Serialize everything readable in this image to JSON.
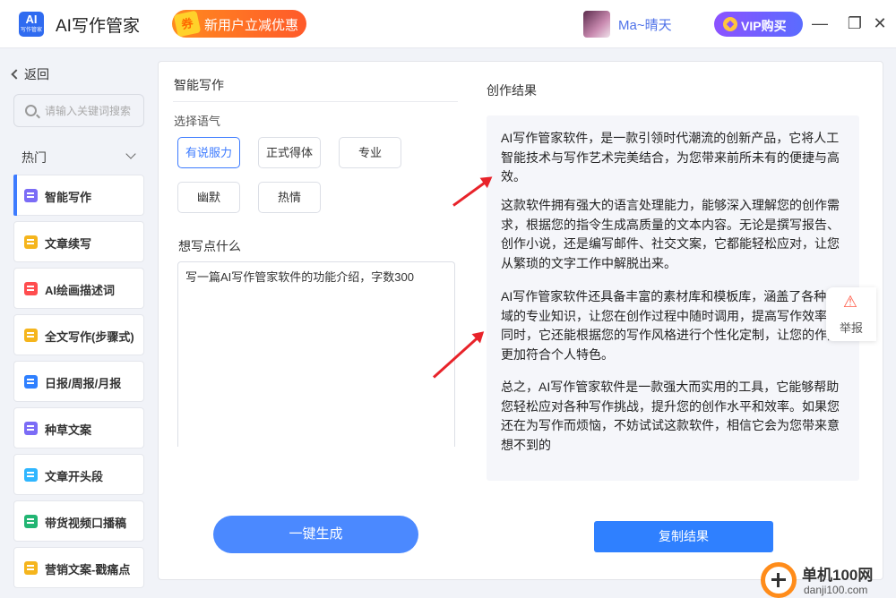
{
  "app": {
    "logo_text": "AI",
    "logo_sub": "写作管家",
    "title": "AI写作管家",
    "promo": "新用户立减优惠",
    "promo_ticket": "券",
    "username": "Ma~晴天",
    "vip_label": "VIP购买"
  },
  "window_controls": {
    "minimize": "—",
    "maximize": "❐",
    "close": "✕"
  },
  "sidebar": {
    "back_label": "返回",
    "search_placeholder": "请输入关键词搜索",
    "section_title": "热门",
    "items": [
      {
        "label": "智能写作",
        "icon": "document-icon",
        "color": "#7b6cf6",
        "active": true
      },
      {
        "label": "文章续写",
        "icon": "notes-icon",
        "color": "#f5b51d",
        "active": false
      },
      {
        "label": "AI绘画描述词",
        "icon": "palette-icon",
        "color": "#ff4d4f",
        "active": false
      },
      {
        "label": "全文写作(步骤式)",
        "icon": "notes-icon",
        "color": "#f5b51d",
        "active": false
      },
      {
        "label": "日报/周报/月报",
        "icon": "calendar-icon",
        "color": "#2f80ff",
        "active": false
      },
      {
        "label": "种草文案",
        "icon": "save-icon",
        "color": "#7b6cf6",
        "active": false
      },
      {
        "label": "文章开头段",
        "icon": "document-icon",
        "color": "#2fb6ff",
        "active": false
      },
      {
        "label": "带货视频口播稿",
        "icon": "video-icon",
        "color": "#22b573",
        "active": false
      },
      {
        "label": "营销文案-戳痛点",
        "icon": "notes-icon",
        "color": "#f5b51d",
        "active": false
      }
    ]
  },
  "writer": {
    "title": "智能写作",
    "tone_label": "选择语气",
    "tones": [
      {
        "label": "有说服力",
        "selected": true
      },
      {
        "label": "正式得体",
        "selected": false
      },
      {
        "label": "专业",
        "selected": false
      },
      {
        "label": "幽默",
        "selected": false
      },
      {
        "label": "热情",
        "selected": false
      }
    ],
    "input_label": "想写点什么",
    "input_value": "写一篇AI写作管家软件的功能介绍，字数300",
    "generate_label": "一键生成"
  },
  "result": {
    "title": "创作结果",
    "paragraphs": [
      "AI写作管家软件，是一款引领时代潮流的创新产品，它将人工智能技术与写作艺术完美结合，为您带来前所未有的便捷与高效。",
      "这款软件拥有强大的语言处理能力，能够深入理解您的创作需求，根据您的指令生成高质量的文本内容。无论是撰写报告、创作小说，还是编写邮件、社交文案，它都能轻松应对，让您从繁琐的文字工作中解脱出来。",
      "AI写作管家软件还具备丰富的素材库和模板库，涵盖了各种领域的专业知识，让您在创作过程中随时调用，提高写作效率。同时，它还能根据您的写作风格进行个性化定制，让您的作品更加符合个人特色。",
      "总之，AI写作管家软件是一款强大而实用的工具，它能够帮助您轻松应对各种写作挑战，提升您的创作水平和效率。如果您还在为写作而烦恼，不妨试试这款软件，相信它会为您带来意想不到的"
    ],
    "copy_label": "复制结果"
  },
  "report": {
    "label": "举报",
    "icon": "alarm-icon"
  },
  "watermark": {
    "name": "单机100网",
    "domain": "danji100.com"
  }
}
